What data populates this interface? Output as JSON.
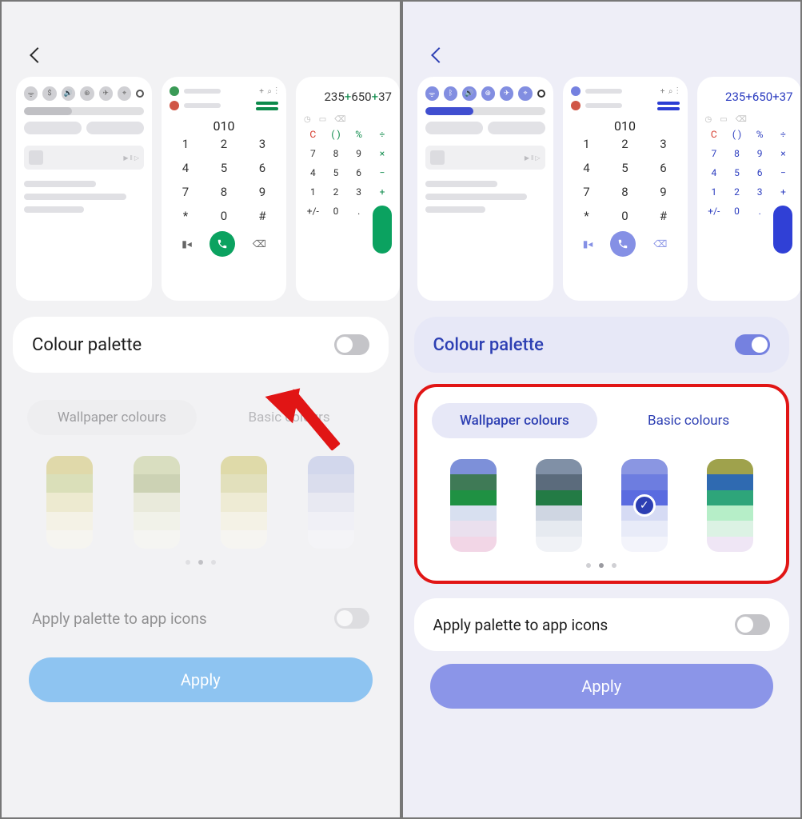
{
  "left": {
    "back_label": "Back",
    "previews": {
      "dialer_display": "010",
      "dialer_top_icons": "+  ⌕  ⋮",
      "keypad": [
        "1",
        "2",
        "3",
        "4",
        "5",
        "6",
        "7",
        "8",
        "9",
        "*",
        "0",
        "#"
      ],
      "calc_expr": "235+650+37"
    },
    "palette_panel": {
      "title": "Colour palette",
      "toggle_on": false
    },
    "tabs": {
      "wallpaper": "Wallpaper colours",
      "basic": "Basic colours",
      "active": "wallpaper"
    },
    "swatches": [
      [
        "#d3c66f",
        "#c8d08a",
        "#e9e5b4",
        "#f6f3dc",
        "#faf8ee"
      ],
      [
        "#c6cf97",
        "#aeb880",
        "#e2e5c7",
        "#f1f2e1",
        "#f8f8f1"
      ],
      [
        "#d0c76c",
        "#d5d28f",
        "#ece7bb",
        "#f6f3db",
        "#faf9f0"
      ],
      [
        "#b9c1e6",
        "#c8cde8",
        "#e0e3f2",
        "#eff0f8",
        "#f7f7fb"
      ]
    ],
    "pager_active": 1,
    "apply_icons_label": "Apply palette to app icons",
    "apply_icons_on": false,
    "apply_button": "Apply"
  },
  "right": {
    "back_label": "Back",
    "previews": {
      "dialer_display": "010",
      "dialer_top_icons": "+  ⌕  ⋮",
      "keypad": [
        "1",
        "2",
        "3",
        "4",
        "5",
        "6",
        "7",
        "8",
        "9",
        "*",
        "0",
        "#"
      ],
      "calc_expr": "235+650+37"
    },
    "palette_panel": {
      "title": "Colour palette",
      "toggle_on": true
    },
    "tabs": {
      "wallpaper": "Wallpaper colours",
      "basic": "Basic colours",
      "active": "wallpaper"
    },
    "swatches": [
      [
        "#7d90d9",
        "#3f7a56",
        "#1f9143",
        "#d8e0f0",
        "#eae0ee",
        "#f2d6e6"
      ],
      [
        "#8090a6",
        "#5b6b7c",
        "#237b45",
        "#cfd6e2",
        "#e6eaf0",
        "#f0f2f6"
      ],
      [
        "#8a96e2",
        "#6d7de0",
        "#5a6be0",
        "#d6dbf4",
        "#e8ebf8",
        "#f3f4fb"
      ],
      [
        "#9fa24c",
        "#2f6ab1",
        "#2ea57a",
        "#b6eec8",
        "#dcf2e4",
        "#efe6f5"
      ]
    ],
    "selected_swatch": 2,
    "pager_active": 1,
    "apply_icons_label": "Apply palette to app icons",
    "apply_icons_on": false,
    "apply_button": "Apply"
  },
  "calc_keys": [
    "C",
    "( )",
    "%",
    "÷",
    "7",
    "8",
    "9",
    "×",
    "4",
    "5",
    "6",
    "−",
    "1",
    "2",
    "3",
    "+",
    "+/-",
    "0",
    ".",
    "="
  ]
}
